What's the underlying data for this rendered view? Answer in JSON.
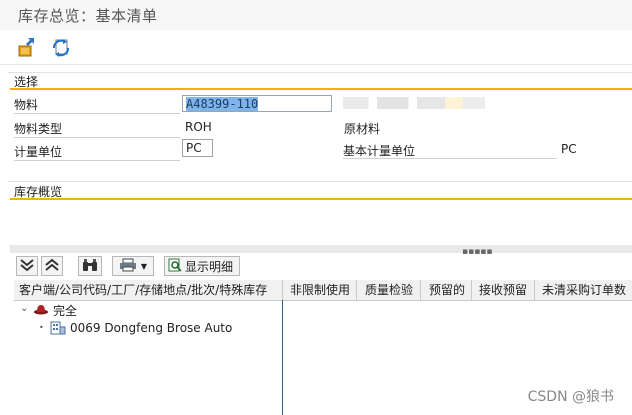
{
  "window": {
    "title": "库存总览：基本清单"
  },
  "toolbar": {
    "icons": [
      "transfer-icon",
      "refresh-icon"
    ]
  },
  "selection": {
    "section_title": "选择",
    "material_label": "物料",
    "material_value": "A48399-110",
    "material_type_label": "物料类型",
    "material_type_value": "ROH",
    "material_type_desc": "原材料",
    "unit_label": "计量单位",
    "unit_value": "PC",
    "base_unit_label": "基本计量单位",
    "base_unit_value": "PC"
  },
  "overview": {
    "section_title": "库存概览"
  },
  "tree_toolbar": {
    "details_label": "显示明细"
  },
  "columns": [
    "客户端/公司代码/工厂/存储地点/批次/特殊库存",
    "非限制使用",
    "质量检验",
    "预留的",
    "接收预留",
    "未清采购订单数"
  ],
  "tree": [
    {
      "label": "完全",
      "icon": "stock-hat-icon"
    },
    {
      "label": "0069 Dongfeng Brose Auto",
      "icon": "company-code-icon"
    }
  ],
  "watermark": "CSDN @狼书"
}
